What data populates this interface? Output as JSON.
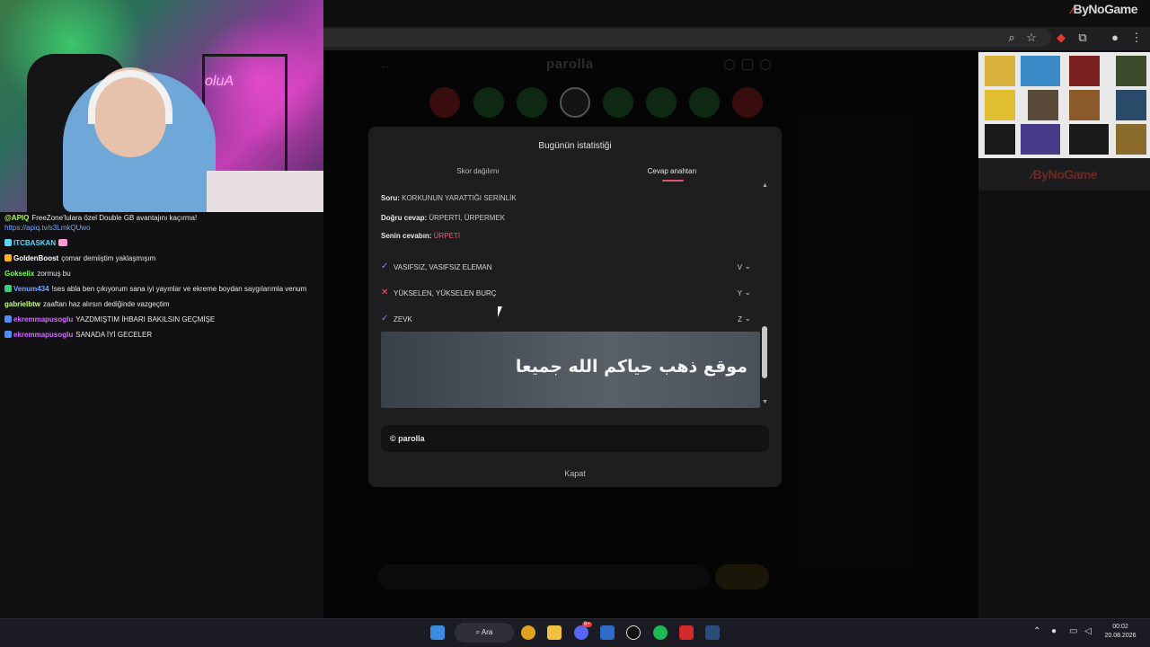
{
  "browser": {
    "brand_logo": "ByNoGame",
    "close_glyph": "×"
  },
  "webcam": {
    "neon_sign": "oluA"
  },
  "chat": [
    {
      "user": "@APIQ",
      "user_color": "#a6ff4a",
      "text": "FreeZone'lulara özel Double GB avantajını kaçırma!",
      "link": "https://apiq.tv/s3LmkQUwo"
    },
    {
      "user": "ITCBASKAN",
      "user_color": "#55d8ff",
      "text": ""
    },
    {
      "user": "GoldenBoost",
      "user_color": "#ffffff",
      "text": "çomar demiiştim yaklaşmışım"
    },
    {
      "user": "Gokselix",
      "user_color": "#7dff5a",
      "text": "zormuş bu"
    },
    {
      "user": "Venum434",
      "user_color": "#7aa5ff",
      "text": "!ses abla ben çıkıyorum sana iyi yayınlar ve ekreme boydan saygılarımla venum"
    },
    {
      "user": "gabrielbtw",
      "user_color": "#c6ff7a",
      "text": "zaaftan haz alırsın dediğinde vazgeçtim"
    },
    {
      "user": "ekremmapusoglu",
      "user_color": "#d36bff",
      "text": "YAZDMIŞTIM İHBARI BAKILSIN GEÇMİŞE"
    },
    {
      "user": "ekremmapusoglu",
      "user_color": "#d36bff",
      "text": "SANADA İYİ GECELER"
    }
  ],
  "app": {
    "title": "parolla",
    "back_glyph": "←"
  },
  "sidebar": {
    "logo": "ByNoGame"
  },
  "modal": {
    "title": "Bugünün istatistiği",
    "tabs": [
      "Skor dağılımı",
      "Cevap anahtarı"
    ],
    "active_tab": "Cevap anahtarı",
    "question_label": "Soru:",
    "question": "KORKUNUN YARATTIĞI SERİNLİK",
    "correct_label": "Doğru cevap:",
    "correct": "ÜRPERTİ, ÜRPERMEK",
    "your_label": "Senin cevabın:",
    "your": "ÜRPETİ",
    "rows": [
      {
        "mark": "✓",
        "mark_color": "#8f7cff",
        "text": "VASIFSIZ, VASIFSIZ ELEMAN",
        "letter": "V"
      },
      {
        "mark": "✕",
        "mark_color": "#ff4f64",
        "text": "YÜKSELEN, YÜKSELEN BURÇ",
        "letter": "Y"
      },
      {
        "mark": "✓",
        "mark_color": "#8f7cff",
        "text": "ZEVK",
        "letter": "Z"
      }
    ],
    "ad_text": "موقع ذهب حياكم الله جميعا",
    "copyright": "© parolla",
    "close_label": "Kapat"
  },
  "taskbar": {
    "search_label": "Ara",
    "time": "00:02",
    "date": "20.08.2026",
    "discord_badge": "9+"
  },
  "colors": {
    "accent_underline": "#e0566a",
    "wrong_answer": "#ef5a6f"
  }
}
